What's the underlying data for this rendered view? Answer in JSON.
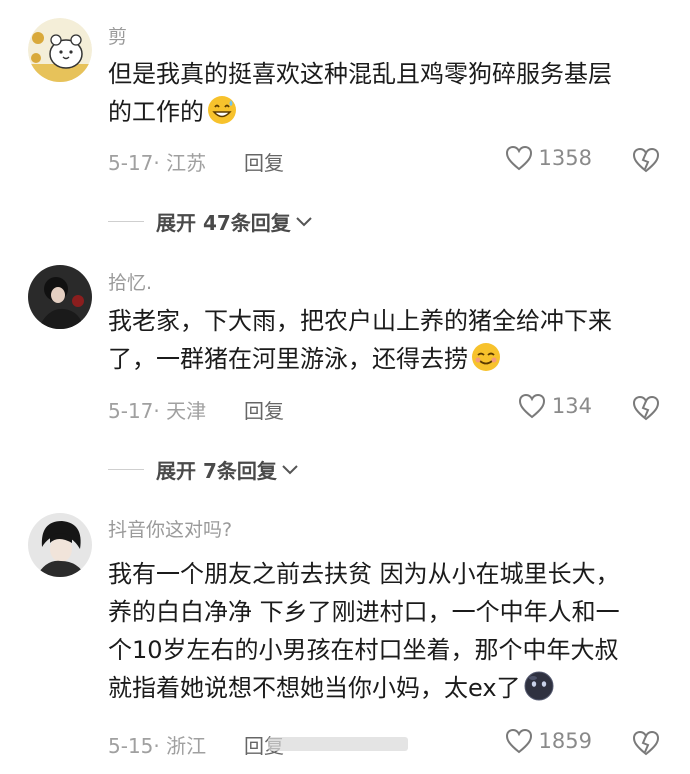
{
  "comments": [
    {
      "username": "剪",
      "text_line1": "但是我真的挺喜欢这种混乱且鸡零狗碎服务基层",
      "text_line2": "的工作的",
      "emoji": "grinning-sweat-emoji",
      "meta": "5-17· 江苏",
      "reply_label": "回复",
      "likes": "1358",
      "expand_label": "展开 47条回复"
    },
    {
      "username": "拾忆.",
      "text_line1": "我老家，下大雨，把农户山上养的猪全给冲下来",
      "text_line2": "了，一群猪在河里游泳，还得去捞",
      "emoji": "smiling-emoji",
      "meta": "5-17· 天津",
      "reply_label": "回复",
      "likes": "134",
      "expand_label": "展开 7条回复"
    },
    {
      "username": "抖音你这对吗?",
      "text_line1": "我有一个朋友之前去扶贫 因为从小在城里长大，",
      "text_line2": "养的白白净净 下乡了刚进村口，一个中年人和一",
      "text_line3": "个10岁左右的小男孩在村口坐着，那个中年大叔",
      "text_line4": "就指着她说想不想她当你小妈，太ex了",
      "emoji": "dark-face-emoji",
      "meta": "5-15· 浙江",
      "reply_label": "回复",
      "likes": "1859"
    }
  ],
  "colors": {
    "text": "#1b1b1b",
    "meta": "#a0a0a0",
    "username": "#9a9a9a"
  }
}
